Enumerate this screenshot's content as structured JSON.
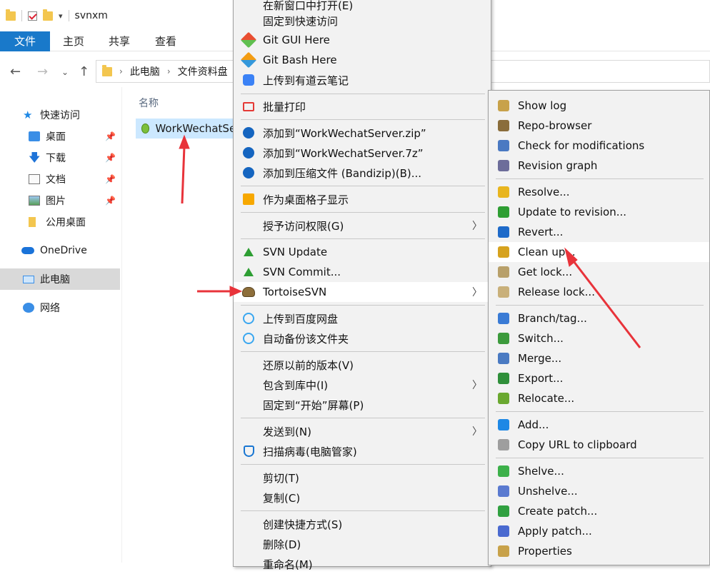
{
  "window": {
    "title": "svnxm"
  },
  "ribbon": {
    "tabs": [
      "文件",
      "主页",
      "共享",
      "查看"
    ]
  },
  "address": {
    "path": [
      "此电脑",
      "文件资料盘"
    ]
  },
  "nav": {
    "quick_access": "快速访问",
    "items": [
      "桌面",
      "下载",
      "文档",
      "图片",
      "公用桌面"
    ],
    "onedrive": "OneDrive",
    "thispc": "此电脑",
    "network": "网络"
  },
  "content": {
    "column_header": "名称",
    "file_name": "WorkWechatServer"
  },
  "context_menu": {
    "items": [
      {
        "label": "在新窗口中打开(E)",
        "icon": "none"
      },
      {
        "label": "固定到快速访问",
        "icon": "none"
      },
      {
        "label": "Git GUI Here",
        "icon": "git-gui-icon"
      },
      {
        "label": "Git Bash Here",
        "icon": "git-bash-icon"
      },
      {
        "label": "上传到有道云笔记",
        "icon": "youdao-icon"
      },
      {
        "label": "批量打印",
        "icon": "printer-icon"
      },
      {
        "label": "添加到“WorkWechatServer.zip”",
        "icon": "bandizip-icon"
      },
      {
        "label": "添加到“WorkWechatServer.7z”",
        "icon": "bandizip-icon"
      },
      {
        "label": "添加到压缩文件 (Bandizip)(B)...",
        "icon": "bandizip-icon"
      },
      {
        "label": "作为桌面格子显示",
        "icon": "grid-icon"
      },
      {
        "label": "授予访问权限(G)",
        "icon": "none",
        "submenu": true
      },
      {
        "label": "SVN Update",
        "icon": "svn-update-icon"
      },
      {
        "label": "SVN Commit...",
        "icon": "svn-commit-icon"
      },
      {
        "label": "TortoiseSVN",
        "icon": "tortoisesvn-icon",
        "submenu": true
      },
      {
        "label": "上传到百度网盘",
        "icon": "baidu-icon"
      },
      {
        "label": "自动备份该文件夹",
        "icon": "baidu-icon"
      },
      {
        "label": "还原以前的版本(V)",
        "icon": "none"
      },
      {
        "label": "包含到库中(I)",
        "icon": "none",
        "submenu": true
      },
      {
        "label": "固定到“开始”屏幕(P)",
        "icon": "none"
      },
      {
        "label": "发送到(N)",
        "icon": "none",
        "submenu": true
      },
      {
        "label": "扫描病毒(电脑管家)",
        "icon": "shield-icon"
      },
      {
        "label": "剪切(T)",
        "icon": "none"
      },
      {
        "label": "复制(C)",
        "icon": "none"
      },
      {
        "label": "创建快捷方式(S)",
        "icon": "none"
      },
      {
        "label": "删除(D)",
        "icon": "none"
      },
      {
        "label": "重命名(M)",
        "icon": "none"
      }
    ]
  },
  "svn_menu": {
    "items": [
      {
        "label": "Show log",
        "icon": "show-log-icon"
      },
      {
        "label": "Repo-browser",
        "icon": "repo-browser-icon"
      },
      {
        "label": "Check for modifications",
        "icon": "check-modifications-icon"
      },
      {
        "label": "Revision graph",
        "icon": "revision-graph-icon"
      },
      {
        "label": "Resolve...",
        "icon": "resolve-icon"
      },
      {
        "label": "Update to revision...",
        "icon": "update-revision-icon"
      },
      {
        "label": "Revert...",
        "icon": "revert-icon"
      },
      {
        "label": "Clean up...",
        "icon": "cleanup-icon"
      },
      {
        "label": "Get lock...",
        "icon": "lock-icon"
      },
      {
        "label": "Release lock...",
        "icon": "unlock-icon"
      },
      {
        "label": "Branch/tag...",
        "icon": "branch-icon"
      },
      {
        "label": "Switch...",
        "icon": "switch-icon"
      },
      {
        "label": "Merge...",
        "icon": "merge-icon"
      },
      {
        "label": "Export...",
        "icon": "export-icon"
      },
      {
        "label": "Relocate...",
        "icon": "relocate-icon"
      },
      {
        "label": "Add...",
        "icon": "add-icon"
      },
      {
        "label": "Copy URL to clipboard",
        "icon": "copy-url-icon"
      },
      {
        "label": "Shelve...",
        "icon": "shelve-icon"
      },
      {
        "label": "Unshelve...",
        "icon": "unshelve-icon"
      },
      {
        "label": "Create patch...",
        "icon": "create-patch-icon"
      },
      {
        "label": "Apply patch...",
        "icon": "apply-patch-icon"
      },
      {
        "label": "Properties",
        "icon": "properties-icon"
      }
    ]
  },
  "colors": {
    "accent": "#1979ca",
    "selection": "#cce8ff",
    "annotation_arrow": "#e8333a"
  }
}
